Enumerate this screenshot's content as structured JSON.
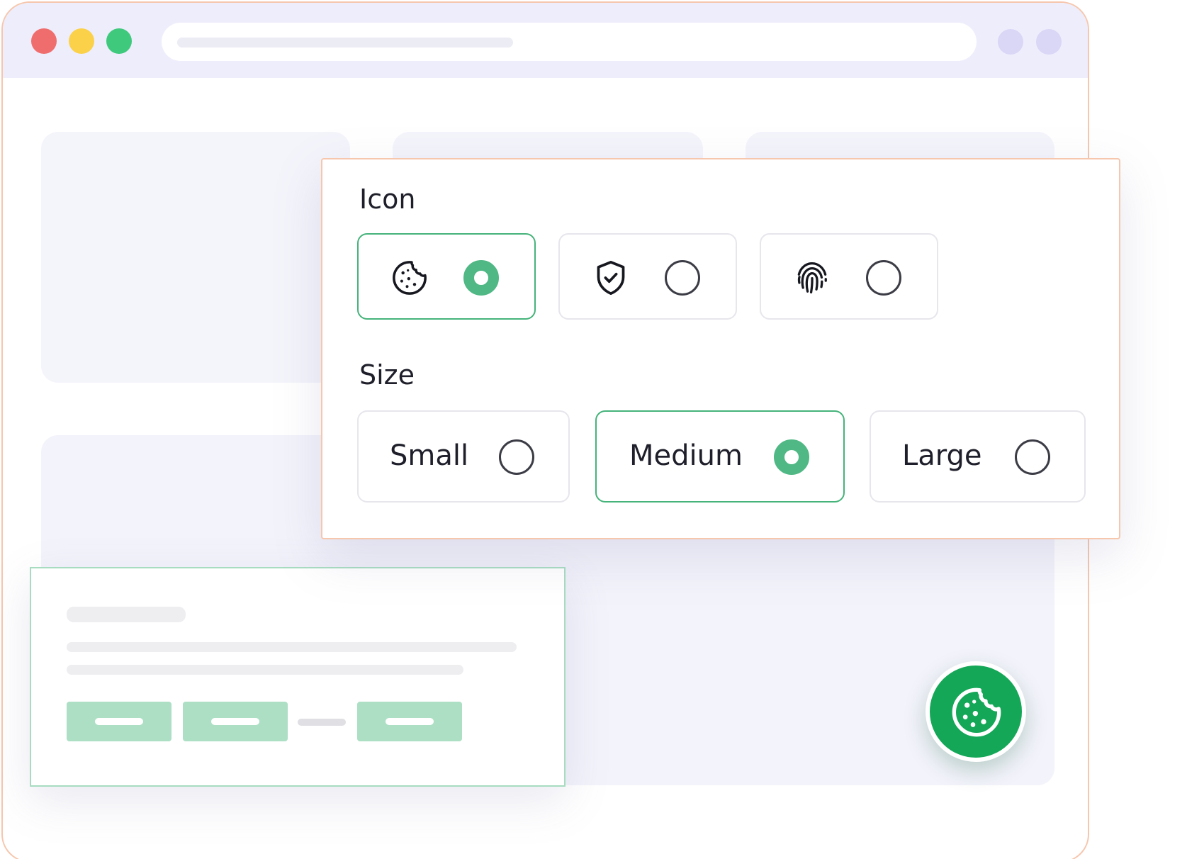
{
  "panel": {
    "icon_label": "Icon",
    "size_label": "Size",
    "icon_options": [
      {
        "icon": "cookie-icon",
        "selected": true
      },
      {
        "icon": "shield-check-icon",
        "selected": false
      },
      {
        "icon": "fingerprint-icon",
        "selected": false
      }
    ],
    "size_options": [
      {
        "label": "Small",
        "selected": false
      },
      {
        "label": "Medium",
        "selected": true
      },
      {
        "label": "Large",
        "selected": false
      }
    ]
  },
  "colors": {
    "accent_green": "#4fb884",
    "fab_green": "#15a758",
    "window_border": "#f6c6ad",
    "titlebar_bg": "#eeedfb",
    "traffic_red": "#f06d6d",
    "traffic_yellow": "#fbd14a",
    "traffic_green": "#3fc97d"
  },
  "fab": {
    "icon": "cookie-icon"
  }
}
